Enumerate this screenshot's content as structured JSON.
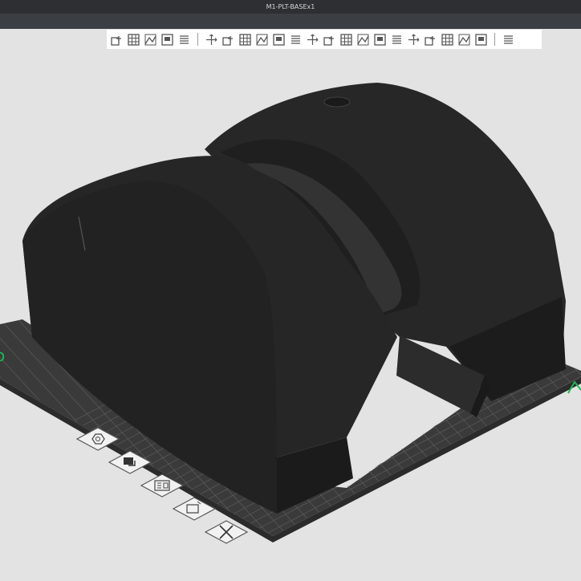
{
  "window": {
    "title": "M1-PLT-BASEx1"
  },
  "toolbar": {
    "groups": [
      [
        "add-part-icon",
        "arrange-grid-icon",
        "layout-icon",
        "slice-preview-icon",
        "layers-icon"
      ],
      [
        "move-icon",
        "rotate-icon",
        "scale-icon",
        "place-on-face-icon",
        "cut-icon",
        "boolean-icon",
        "support-paint-icon",
        "seam-paint-icon",
        "text-tool-icon",
        "measure-icon",
        "assembly-icon",
        "split-objects-icon",
        "split-parts-icon",
        "variable-layer-icon",
        "modifier-icon",
        "mesh-repair-icon",
        "ruler-icon"
      ],
      [
        "view-settings-icon"
      ]
    ]
  },
  "viewport": {
    "colors": {
      "background": "#e3e3e3",
      "plate": "#3a3a3a",
      "grid": "#5a5a5a",
      "model": "#262626",
      "model_shadow": "#1c1c1c",
      "axis_x": "#1db954"
    }
  },
  "side_tools": [
    {
      "name": "auto-orient-button",
      "icon": "hexagon-nut-icon"
    },
    {
      "name": "plate-settings-button",
      "icon": "plate-icon"
    },
    {
      "name": "arrange-button",
      "icon": "arrange-icon"
    },
    {
      "name": "plate-label-button",
      "icon": "plate-label-icon"
    },
    {
      "name": "delete-plate-button",
      "icon": "close-icon"
    }
  ]
}
